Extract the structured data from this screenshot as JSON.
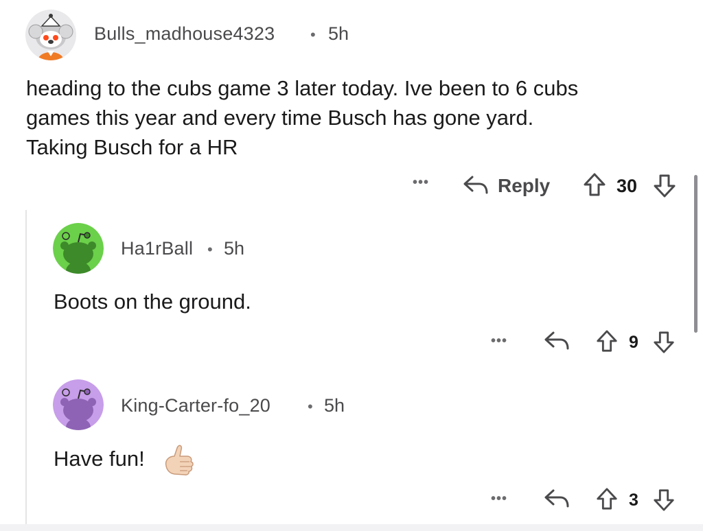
{
  "comments": [
    {
      "username": "Bulls_madhouse4323",
      "separator": "•",
      "time": "5h",
      "text": "heading to the cubs game 3 later today. Ive been to 6 cubs\ngames this year and every time Busch has gone yard.\nTaking Busch for a HR",
      "reply_label": "Reply",
      "votes": "30",
      "more_label": "•••"
    },
    {
      "username": "Ha1rBall",
      "separator": "•",
      "time": "5h",
      "text": "Boots on the ground.",
      "votes": "9",
      "more_label": "•••",
      "avatar_color": "#6bd04a"
    },
    {
      "username": "King-Carter-fo_20",
      "separator": "•",
      "time": "5h",
      "text": "Have fun!",
      "votes": "3",
      "more_label": "•••",
      "avatar_color": "#c79ee9"
    }
  ],
  "colors": {
    "text_primary": "#1a1a1b",
    "text_meta": "#4a4a4c",
    "thread_line": "#e4e4e6"
  },
  "icons": [
    "reply-arrow-icon",
    "upvote-arrow-icon",
    "downvote-arrow-icon",
    "more-options-icon",
    "call-me-hand-emoji"
  ]
}
